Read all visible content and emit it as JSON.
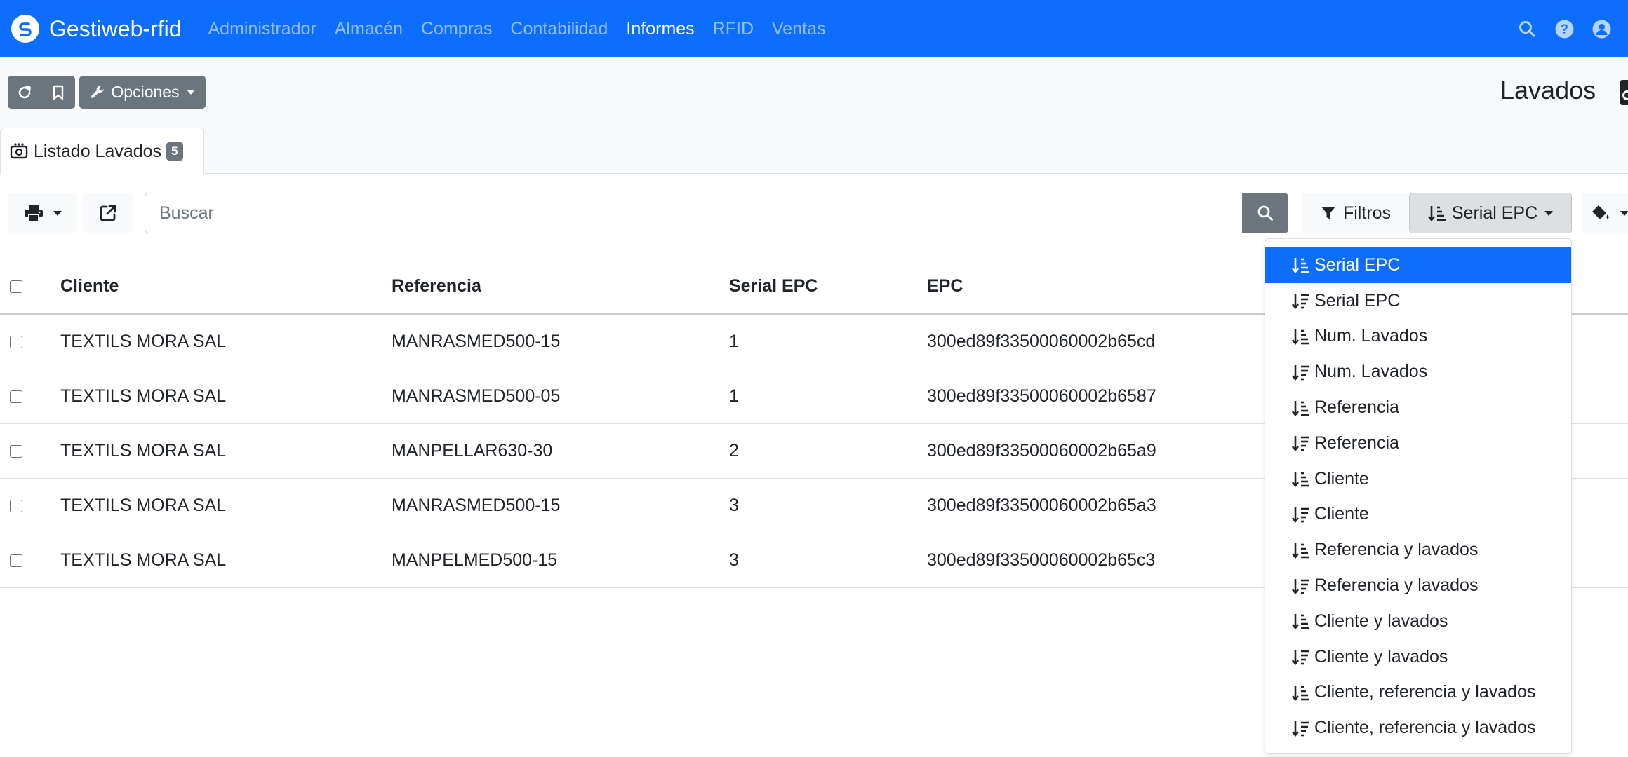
{
  "navbar": {
    "brand": "Gestiweb-rfid",
    "items": [
      {
        "label": "Administrador"
      },
      {
        "label": "Almacén"
      },
      {
        "label": "Compras"
      },
      {
        "label": "Contabilidad"
      },
      {
        "label": "Informes"
      },
      {
        "label": "RFID"
      },
      {
        "label": "Ventas"
      }
    ],
    "active_item": "Informes"
  },
  "toolbar": {
    "options_label": "Opciones"
  },
  "page": {
    "title": "Lavados"
  },
  "tab": {
    "label": "Listado Lavados",
    "badge": "5"
  },
  "search": {
    "placeholder": "Buscar",
    "value": ""
  },
  "filters_label": "Filtros",
  "sort": {
    "selected_label": "Serial EPC",
    "options": [
      {
        "label": "Serial EPC",
        "direction": "asc",
        "active": true
      },
      {
        "label": "Serial EPC",
        "direction": "desc"
      },
      {
        "label": "Num. Lavados",
        "direction": "asc"
      },
      {
        "label": "Num. Lavados",
        "direction": "desc"
      },
      {
        "label": "Referencia",
        "direction": "asc"
      },
      {
        "label": "Referencia",
        "direction": "desc"
      },
      {
        "label": "Cliente",
        "direction": "asc"
      },
      {
        "label": "Cliente",
        "direction": "desc"
      },
      {
        "label": "Referencia y lavados",
        "direction": "asc"
      },
      {
        "label": "Referencia y lavados",
        "direction": "desc"
      },
      {
        "label": "Cliente y lavados",
        "direction": "asc"
      },
      {
        "label": "Cliente y lavados",
        "direction": "desc"
      },
      {
        "label": "Cliente, referencia y lavados",
        "direction": "asc"
      },
      {
        "label": "Cliente, referencia y lavados",
        "direction": "desc"
      }
    ]
  },
  "table": {
    "columns": [
      "Cliente",
      "Referencia",
      "Serial EPC",
      "EPC"
    ],
    "rows": [
      [
        "TEXTILS MORA SAL",
        "MANRASMED500-15",
        "1",
        "300ed89f33500060002b65cd"
      ],
      [
        "TEXTILS MORA SAL",
        "MANRASMED500-05",
        "1",
        "300ed89f33500060002b6587"
      ],
      [
        "TEXTILS MORA SAL",
        "MANPELLAR630-30",
        "2",
        "300ed89f33500060002b65a9"
      ],
      [
        "TEXTILS MORA SAL",
        "MANRASMED500-15",
        "3",
        "300ed89f33500060002b65a3"
      ],
      [
        "TEXTILS MORA SAL",
        "MANPELMED500-15",
        "3",
        "300ed89f33500060002b65c3"
      ]
    ]
  },
  "colors": {
    "navbar": "#0d6efd",
    "nav_inactive": "rgba(255,255,255,0.55)",
    "secondary": "#6c757d",
    "active_item": "#0d6efd"
  },
  "icons": {
    "brand": "brand-logo-icon",
    "search": "search-icon",
    "help": "help-icon",
    "user": "user-icon",
    "refresh": "refresh-icon",
    "bookmark": "bookmark-icon",
    "options": "wrench-icon",
    "title": "washing-icon",
    "print": "print-icon",
    "export": "external-link-icon",
    "filter": "filter-icon",
    "sort_asc": "sort-amount-asc-icon",
    "sort_desc": "sort-amount-desc-icon",
    "paint": "paint-bucket-icon"
  }
}
